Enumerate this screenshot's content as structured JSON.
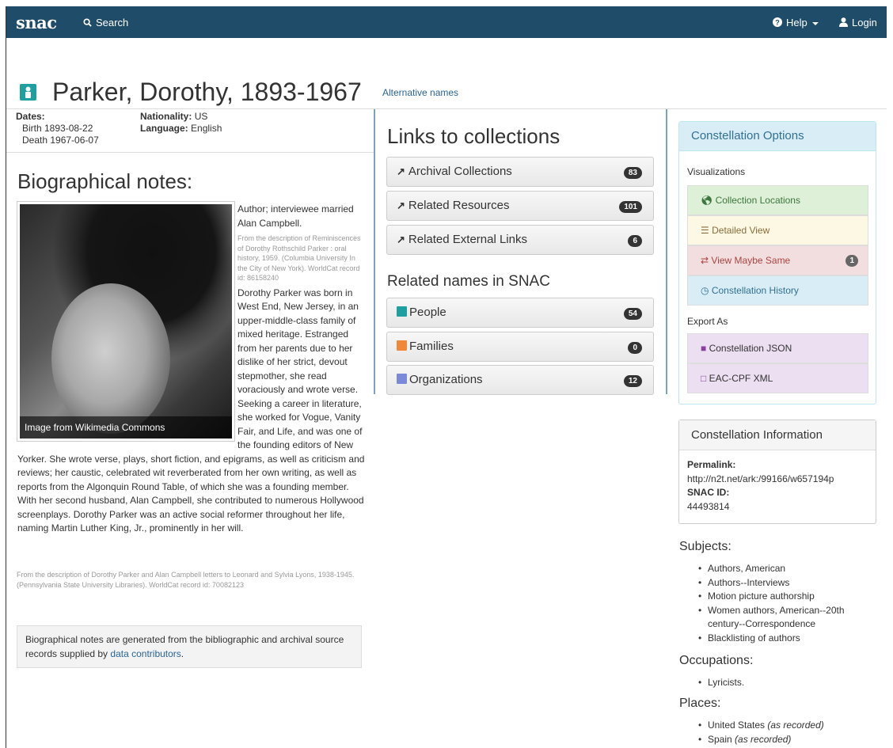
{
  "nav": {
    "brand": "snac",
    "search": "Search",
    "help": "Help",
    "login": "Login"
  },
  "title": {
    "name": "Parker, Dorothy, 1893-1967",
    "alt_names": "Alternative names"
  },
  "meta": {
    "dates_label": "Dates:",
    "birth": "Birth 1893-08-22",
    "death": "Death 1967-06-07",
    "nationality_label": "Nationality:",
    "nationality": "US",
    "language_label": "Language:",
    "language": "English"
  },
  "bio": {
    "heading": "Biographical notes:",
    "photo_caption": "Image from Wikimedia Commons",
    "intro": "Author; interviewee married Alan Campbell.",
    "intro_source": "From the description of Reminiscences of Dorothy Rothschild Parker : oral history, 1959. (Columbia University In the City of New York). WorldCat record id: 86158240",
    "main": "Dorothy Parker was born in West End, New Jersey, in an upper-middle-class family of mixed heritage. Estranged from her parents due to her dislike of her strict, devout stepmother, she read voraciously and wrote verse. Seeking a career in literature, she worked for Vogue, Vanity Fair, and Life, and was one of the founding editors of New Yorker. She wrote verse, plays, short fiction, and epigrams, as well as criticism and reviews; her caustic, celebrated wit reverberated from her own writing, as well as reports from the Algonquin Round Table, of which she was a founding member. With her second husband, Alan Campbell, she contributed to numerous Hollywood screenplays. Dorothy Parker was an active social reformer throughout her life, naming Martin Luther King, Jr., prominently in her will.",
    "main_source": "From the description of Dorothy Parker and Alan Campbell letters to Leonard and Sylvia Lyons, 1938-1945. (Pennsylvania State University Libraries). WorldCat record id: 70082123",
    "note_text": "Biographical notes are generated from the bibliographic and archival source records supplied by",
    "note_link": "data contributors",
    "note_end": "."
  },
  "links": {
    "heading": "Links to collections",
    "items": [
      {
        "label": "Archival Collections",
        "count": "83"
      },
      {
        "label": "Related Resources",
        "count": "101"
      },
      {
        "label": "Related External Links",
        "count": "6"
      }
    ]
  },
  "related": {
    "heading": "Related names in SNAC",
    "items": [
      {
        "label": "People",
        "count": "54",
        "color": "#1fa0a0"
      },
      {
        "label": "Families",
        "count": "0",
        "color": "#f0883a"
      },
      {
        "label": "Organizations",
        "count": "12",
        "color": "#7a8ad8"
      }
    ]
  },
  "options": {
    "heading": "Constellation Options",
    "visualizations_label": "Visualizations",
    "visualizations": [
      {
        "label": "Collection Locations",
        "bg": "#dff0d8"
      },
      {
        "label": "Detailed View",
        "bg": "#fcf8e3"
      },
      {
        "label": "View Maybe Same",
        "bg": "#f2dede",
        "badge": "1"
      },
      {
        "label": "Constellation History",
        "bg": "#d9edf7"
      }
    ],
    "export_label": "Export As",
    "exports": [
      {
        "label": "Constellation JSON",
        "bg": "#ecdff2"
      },
      {
        "label": "EAC-CPF XML",
        "bg": "#ecdff2"
      }
    ]
  },
  "info": {
    "heading": "Constellation Information",
    "permalink_label": "Permalink:",
    "permalink": "http://n2t.net/ark:/99166/w657194p",
    "snac_id_label": "SNAC ID:",
    "snac_id": "44493814"
  },
  "subjects": {
    "heading": "Subjects:",
    "items": [
      "Authors, American",
      "Authors--Interviews",
      "Motion picture authorship",
      "Women authors, American--20th century--Correspondence",
      "Blacklisting of authors"
    ]
  },
  "occupations": {
    "heading": "Occupations:",
    "items": [
      "Lyricists."
    ]
  },
  "places": {
    "heading": "Places:",
    "items": [
      {
        "name": "United States",
        "note": "(as recorded)"
      },
      {
        "name": "Spain",
        "note": "(as recorded)"
      }
    ]
  }
}
